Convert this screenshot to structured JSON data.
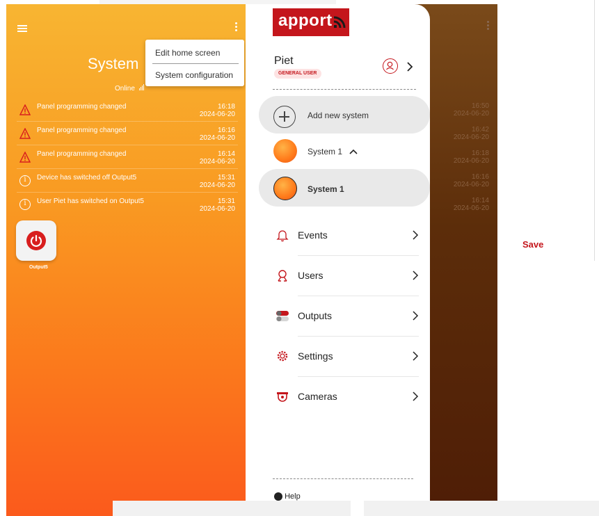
{
  "left": {
    "title": "System",
    "status": "Online",
    "dropdown": [
      "Edit home screen",
      "System configuration"
    ],
    "events": [
      {
        "type": "warning",
        "text": "Panel programming changed",
        "time": "16:18",
        "date": "2024-06-20"
      },
      {
        "type": "warning",
        "text": "Panel programming changed",
        "time": "16:16",
        "date": "2024-06-20"
      },
      {
        "type": "warning",
        "text": "Panel programming changed",
        "time": "16:14",
        "date": "2024-06-20"
      },
      {
        "type": "info",
        "text": "Device has switched off Output5",
        "time": "15:31",
        "date": "2024-06-20"
      },
      {
        "type": "info",
        "text": "User Piet has switched on Output5",
        "time": "15:31",
        "date": "2024-06-20"
      }
    ],
    "output_label": "Output5"
  },
  "drawer": {
    "logo": "apport",
    "user_name": "Piet",
    "role": "GENERAL USER",
    "add_system": "Add new system",
    "system_group": "System 1",
    "selected_system": "System 1",
    "menu": [
      "Events",
      "Users",
      "Outputs",
      "Settings",
      "Cameras"
    ],
    "help": "Help"
  },
  "background": {
    "times": [
      {
        "time": "16:50",
        "date": "2024-06-20"
      },
      {
        "time": "16:42",
        "date": "2024-06-20"
      },
      {
        "time": "16:18",
        "date": "2024-06-20"
      },
      {
        "time": "16:16",
        "date": "2024-06-20"
      },
      {
        "time": "16:14",
        "date": "2024-06-20"
      }
    ],
    "save_label": "Save"
  },
  "colors": {
    "brand_red": "#c4161c",
    "orange_top": "#f8b532",
    "orange_bottom": "#fb5a1c"
  }
}
